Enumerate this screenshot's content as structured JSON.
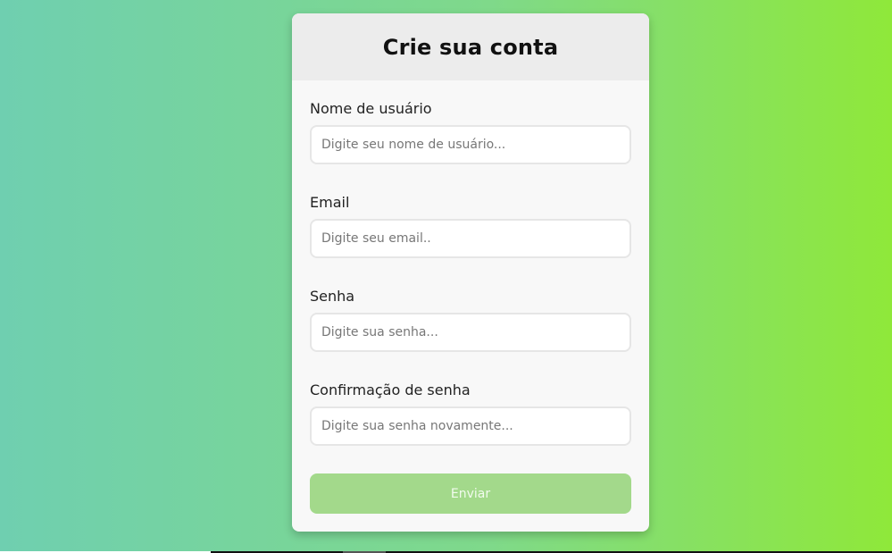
{
  "form": {
    "title": "Crie sua conta",
    "fields": [
      {
        "label": "Nome de usuário",
        "placeholder": "Digite seu nome de usuário...",
        "value": ""
      },
      {
        "label": "Email",
        "placeholder": "Digite seu email..",
        "value": ""
      },
      {
        "label": "Senha",
        "placeholder": "Digite sua senha...",
        "value": ""
      },
      {
        "label": "Confirmação de senha",
        "placeholder": "Digite sua senha novamente...",
        "value": ""
      }
    ],
    "submit_label": "Enviar"
  },
  "colors": {
    "background_left": "#6fcfb0",
    "background_right": "#8fe83a",
    "card": "#f8f8f8",
    "header": "#ececec",
    "button": "#a3d98b"
  }
}
